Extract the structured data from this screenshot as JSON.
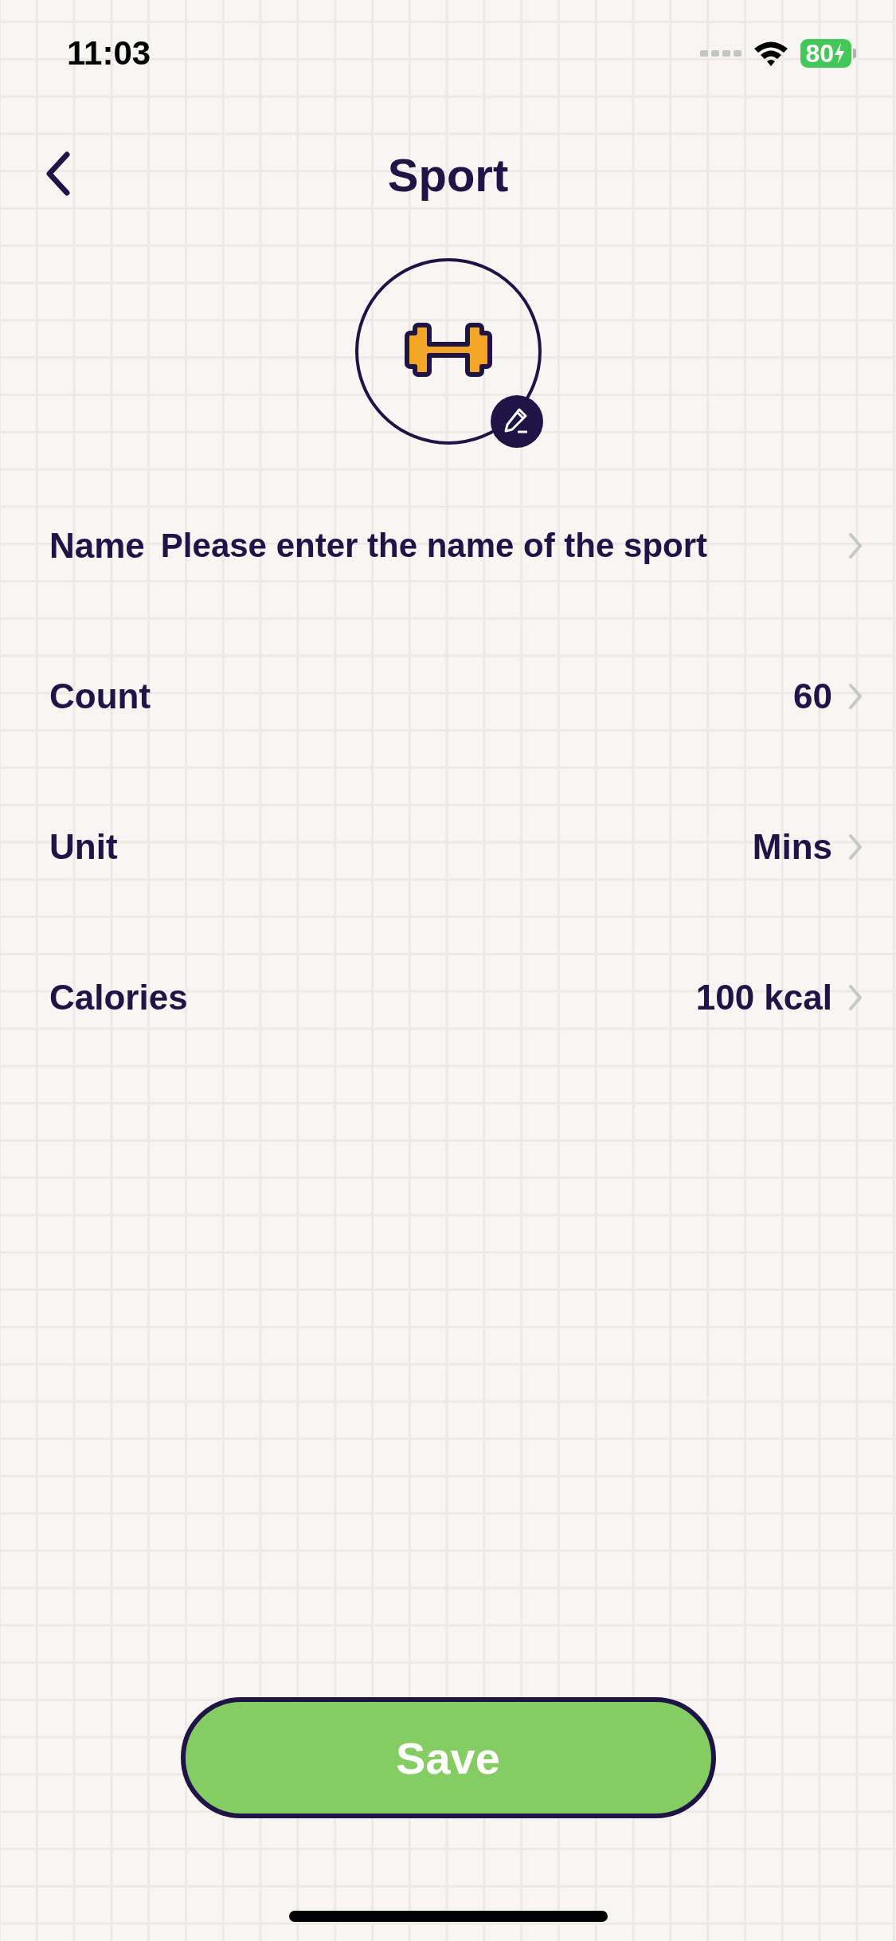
{
  "status_bar": {
    "time": "11:03",
    "battery": "80"
  },
  "header": {
    "title": "Sport"
  },
  "fields": [
    {
      "label": "Name",
      "placeholder": "Please enter the name of the sport"
    },
    {
      "label": "Count",
      "value": "60"
    },
    {
      "label": "Unit",
      "value": "Mins"
    },
    {
      "label": "Calories",
      "value": "100 kcal"
    }
  ],
  "save_button": "Save"
}
